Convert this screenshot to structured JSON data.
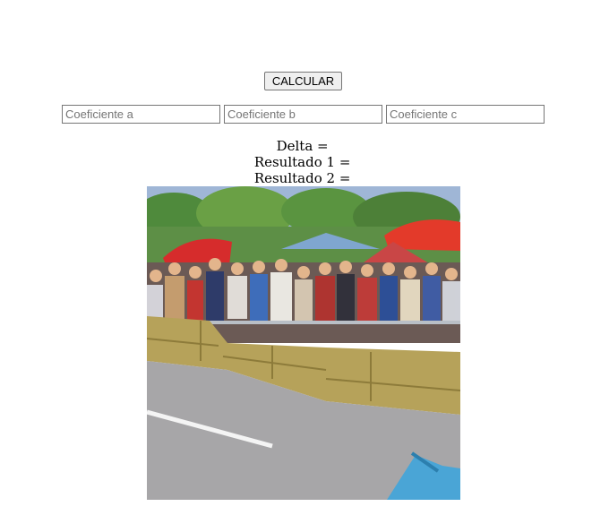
{
  "toolbar": {
    "calculate_label": "CALCULAR"
  },
  "inputs": {
    "a": {
      "placeholder": "Coeficiente a",
      "value": ""
    },
    "b": {
      "placeholder": "Coeficiente b",
      "value": ""
    },
    "c": {
      "placeholder": "Coeficiente c",
      "value": ""
    }
  },
  "results": {
    "delta_label": "Delta = ",
    "resultado1_label": "Resultado 1 = ",
    "resultado2_label": "Resultado 2 = "
  }
}
